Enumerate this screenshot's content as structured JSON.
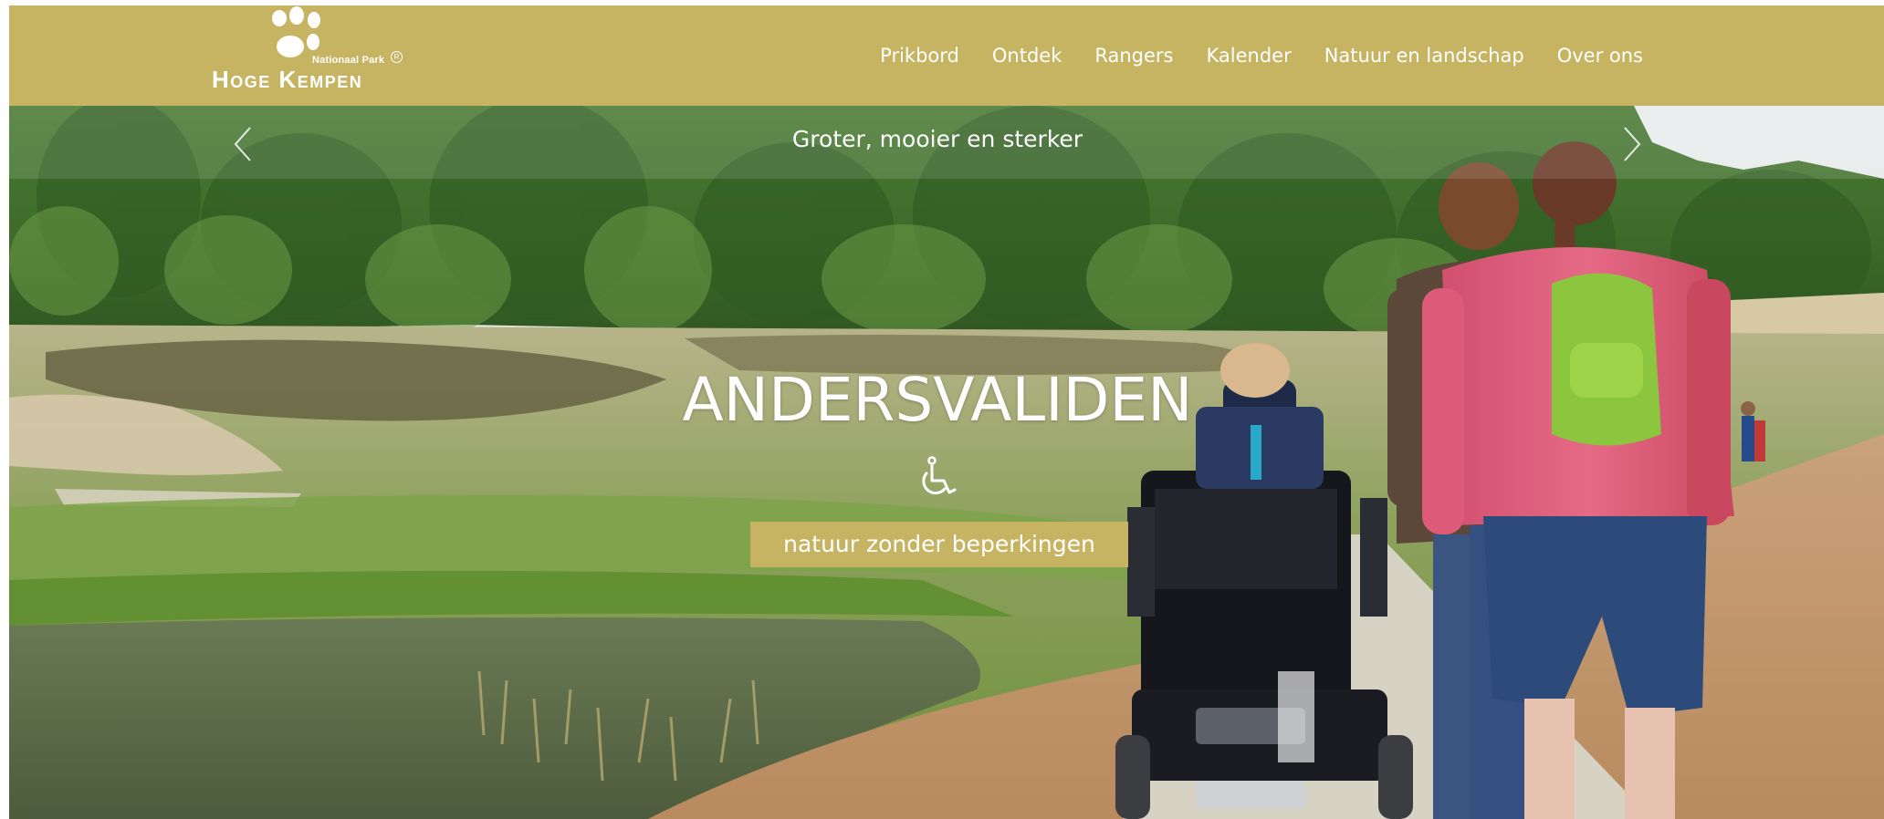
{
  "header": {
    "logo_small": "Nationaal Park",
    "logo_reg": "R",
    "logo_big": "Hoge Kempen",
    "nav": [
      "Prikbord",
      "Ontdek",
      "Rangers",
      "Kalender",
      "Natuur en landschap",
      "Over ons"
    ]
  },
  "hero": {
    "caption": "Groter, mooier en sterker",
    "title": "ANDERSVALIDEN",
    "cta": "natuur zonder beperkingen",
    "icon": "wheelchair-icon"
  },
  "colors": {
    "brand": "#c6b463",
    "text": "#ffffff"
  }
}
